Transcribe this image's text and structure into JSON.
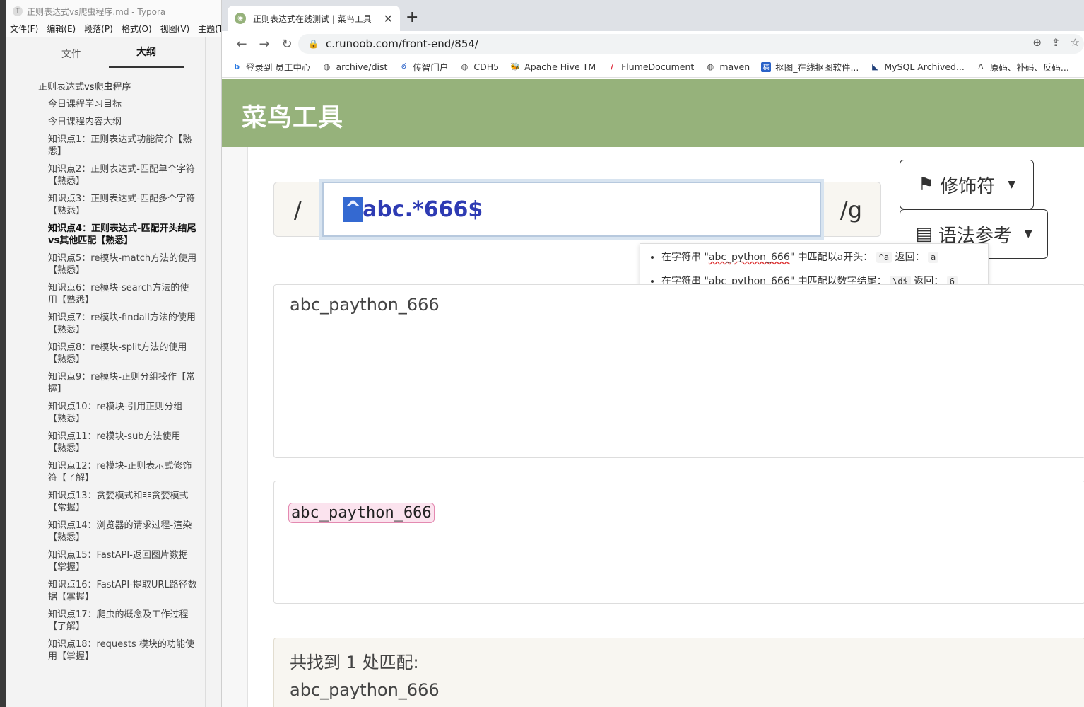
{
  "typora": {
    "window_title": "正则表达式vs爬虫程序.md - Typora",
    "menu": [
      "文件(F)",
      "编辑(E)",
      "段落(P)",
      "格式(O)",
      "视图(V)",
      "主题(T)"
    ],
    "tabs": [
      "文件",
      "大纲"
    ],
    "outline_root": "正则表达式vs爬虫程序",
    "outline_items": [
      "今日课程学习目标",
      "今日课程内容大纲",
      "知识点1：正则表达式功能简介【熟悉】",
      "知识点2：正则表达式-匹配单个字符【熟悉】",
      "知识点3：正则表达式-匹配多个字符【熟悉】",
      "知识点4：正则表达式-匹配开头结尾vs其他匹配【熟悉】",
      "知识点5：re模块-match方法的使用【熟悉】",
      "知识点6：re模块-search方法的使用【熟悉】",
      "知识点7：re模块-findall方法的使用【熟悉】",
      "知识点8：re模块-split方法的使用【熟悉】",
      "知识点9：re模块-正则分组操作【常握】",
      "知识点10：re模块-引用正则分组【熟悉】",
      "知识点11：re模块-sub方法使用【熟悉】",
      "知识点12：re模块-正则表示式修饰符【了解】",
      "知识点13：贪婪模式和非贪婪模式【常握】",
      "知识点14：浏览器的请求过程-渲染【熟悉】",
      "知识点15：FastAPI-返回图片数据【掌握】",
      "知识点16：FastAPI-提取URL路径数据【掌握】",
      "知识点17：爬虫的概念及工作过程【了解】",
      "知识点18：requests 模块的功能使用【掌握】"
    ]
  },
  "chrome": {
    "tab_title": "正则表达式在线测试 | 菜鸟工具",
    "url": "c.runoob.com/front-end/854/",
    "bookmarks": [
      {
        "icon": "b",
        "label": "登录到 员工中心"
      },
      {
        "icon": "◍",
        "label": "archive/dist"
      },
      {
        "icon": "ఠ",
        "label": "传智门户"
      },
      {
        "icon": "◍",
        "label": "CDH5"
      },
      {
        "icon": "🐝",
        "label": "Apache Hive TM"
      },
      {
        "icon": "/",
        "label": "FlumeDocument"
      },
      {
        "icon": "◍",
        "label": "maven"
      },
      {
        "icon": "稿",
        "label": "抠图_在线抠图软件..."
      },
      {
        "icon": "◣",
        "label": "MySQL Archived..."
      },
      {
        "icon": "ᐱ",
        "label": "原码、补码、反码..."
      }
    ]
  },
  "page": {
    "brand": "菜鸟工具",
    "regex_prefix": "/",
    "regex_first_char": "^",
    "regex_rest": "abc.*666$",
    "regex_flags": "/g",
    "modifier_button": "修饰符",
    "syntax_button": "语法参考",
    "tooltip": [
      {
        "pre": "在字符串 \"",
        "str": "abc_python_666",
        "post": "\" 中匹配以a开头：",
        "code": "^a",
        "ret": "返回：",
        "val": "a"
      },
      {
        "pre": "在字符串 \"",
        "str": "abc_python_666",
        "post": "\" 中匹配以数字结尾：",
        "code": "\\d$",
        "ret": "返回：",
        "val": "6"
      }
    ],
    "test_text": "abc_paython_666",
    "match_text": "abc_paython_666",
    "summary_title": "共找到 1 处匹配:",
    "summary_match": "abc_paython_666"
  },
  "colors": {
    "brand_green": "#96b27b",
    "regex_blue": "#2e3bb3",
    "match_pink": "#fbe3ee"
  }
}
